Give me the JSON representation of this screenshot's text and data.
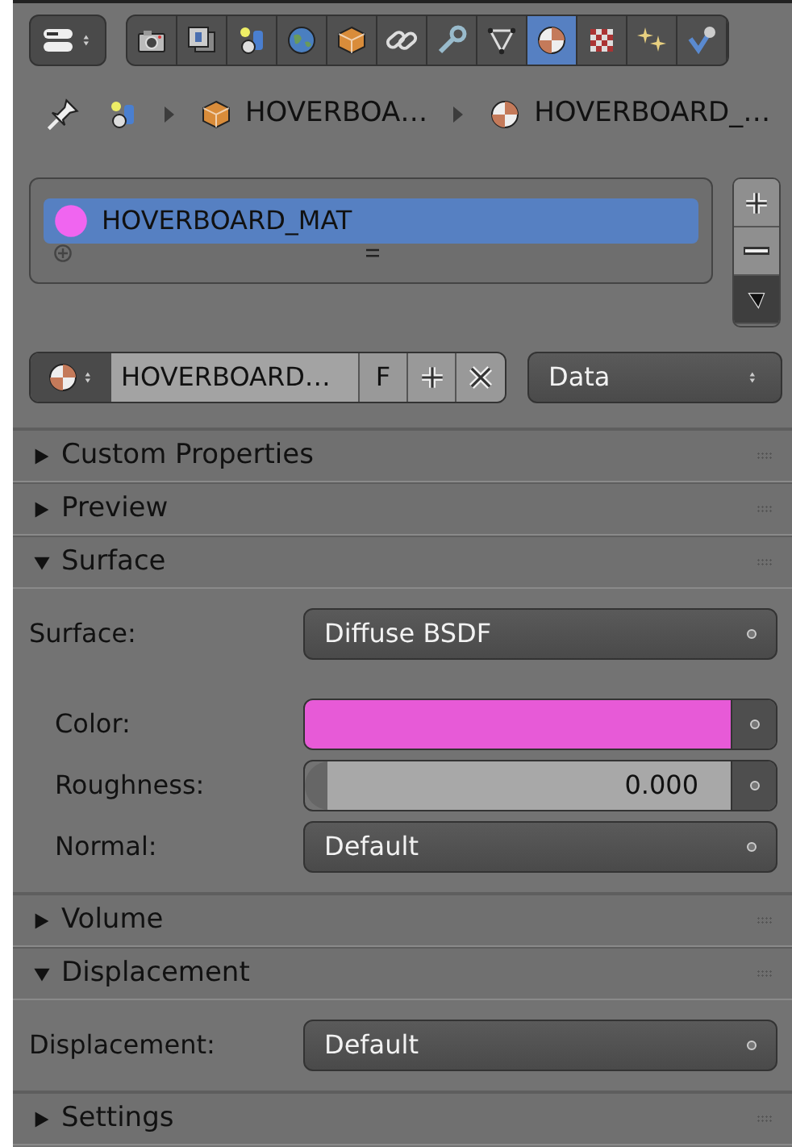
{
  "tabs": [
    {
      "kind": "render",
      "selected": false
    },
    {
      "kind": "layers",
      "selected": false
    },
    {
      "kind": "scene",
      "selected": false
    },
    {
      "kind": "world",
      "selected": false
    },
    {
      "kind": "object",
      "selected": false
    },
    {
      "kind": "constraints",
      "selected": false
    },
    {
      "kind": "modifiers",
      "selected": false
    },
    {
      "kind": "data",
      "selected": false
    },
    {
      "kind": "material",
      "selected": true
    },
    {
      "kind": "texture",
      "selected": false
    },
    {
      "kind": "particles",
      "selected": false
    },
    {
      "kind": "physics",
      "selected": false
    }
  ],
  "breadcrumb": [
    {
      "kind": "scene"
    },
    {
      "kind": "object",
      "label": "HOVERBOA…"
    },
    {
      "kind": "material",
      "label": "HOVERBOARD_…"
    }
  ],
  "material_slots": [
    {
      "name": "HOVERBOARD_MAT",
      "selected": true
    }
  ],
  "datablock": {
    "name": "HOVERBOARD…",
    "fake_user": "F",
    "link": "Data"
  },
  "panels": [
    {
      "title": "Custom Properties",
      "expanded": false
    },
    {
      "title": "Preview",
      "expanded": false
    },
    {
      "title": "Surface",
      "expanded": true,
      "fields": [
        {
          "label": "Surface:",
          "kind": "dropdown",
          "value": "Diffuse BSDF"
        }
      ],
      "inputs": [
        {
          "label": "Color:",
          "kind": "color",
          "color": "#e75ad7"
        },
        {
          "label": "Roughness:",
          "kind": "number",
          "value": "0.000"
        },
        {
          "label": "Normal:",
          "kind": "dropdown",
          "value": "Default"
        }
      ]
    },
    {
      "title": "Volume",
      "expanded": false
    },
    {
      "title": "Displacement",
      "expanded": true,
      "fields": [
        {
          "label": "Displacement:",
          "kind": "dropdown",
          "value": "Default"
        }
      ]
    },
    {
      "title": "Settings",
      "expanded": false
    }
  ]
}
